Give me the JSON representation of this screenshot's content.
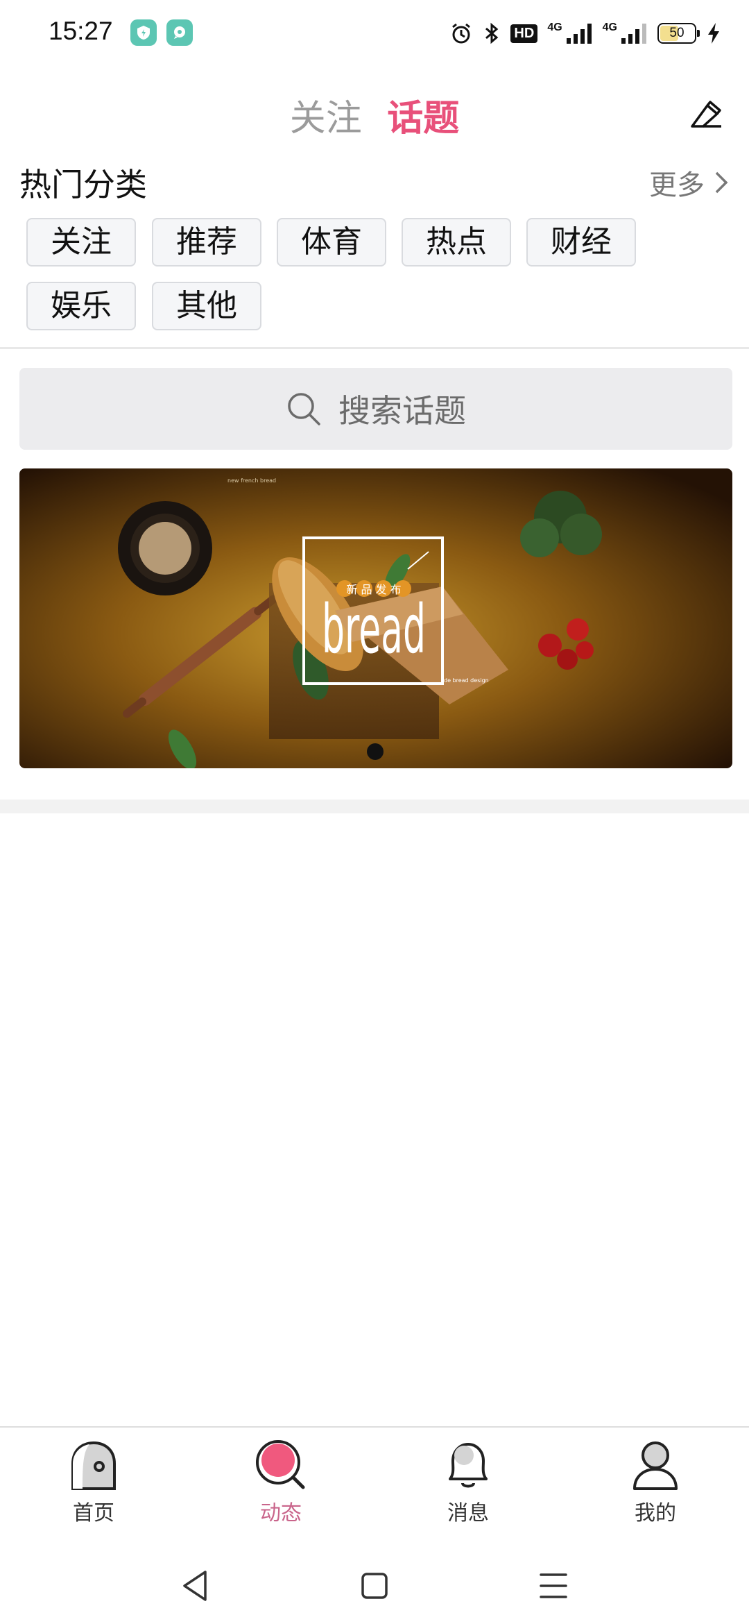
{
  "status_bar": {
    "time": "15:27",
    "hd_label": "HD",
    "signal1_label": "4G",
    "signal2_label": "4G",
    "battery_level": "50"
  },
  "header": {
    "tabs": [
      {
        "label": "关注",
        "active": false
      },
      {
        "label": "话题",
        "active": true
      }
    ],
    "edit_icon": "edit-icon"
  },
  "categories": {
    "title": "热门分类",
    "more_label": "更多",
    "items": [
      "关注",
      "推荐",
      "体育",
      "热点",
      "财经",
      "娱乐",
      "其他"
    ]
  },
  "search": {
    "placeholder": "搜索话题"
  },
  "banner": {
    "word": "bread",
    "tagline": "新 品 发 布",
    "sub_text": "new french bread",
    "corner_text": "de bread design"
  },
  "bottom_nav": {
    "items": [
      {
        "label": "首页",
        "icon": "home-icon",
        "active": false
      },
      {
        "label": "动态",
        "icon": "discover-icon",
        "active": true
      },
      {
        "label": "消息",
        "icon": "bell-icon",
        "active": false
      },
      {
        "label": "我的",
        "icon": "profile-icon",
        "active": false
      }
    ]
  },
  "colors": {
    "accent": "#e8507a",
    "active_nav": "#c9658b"
  }
}
